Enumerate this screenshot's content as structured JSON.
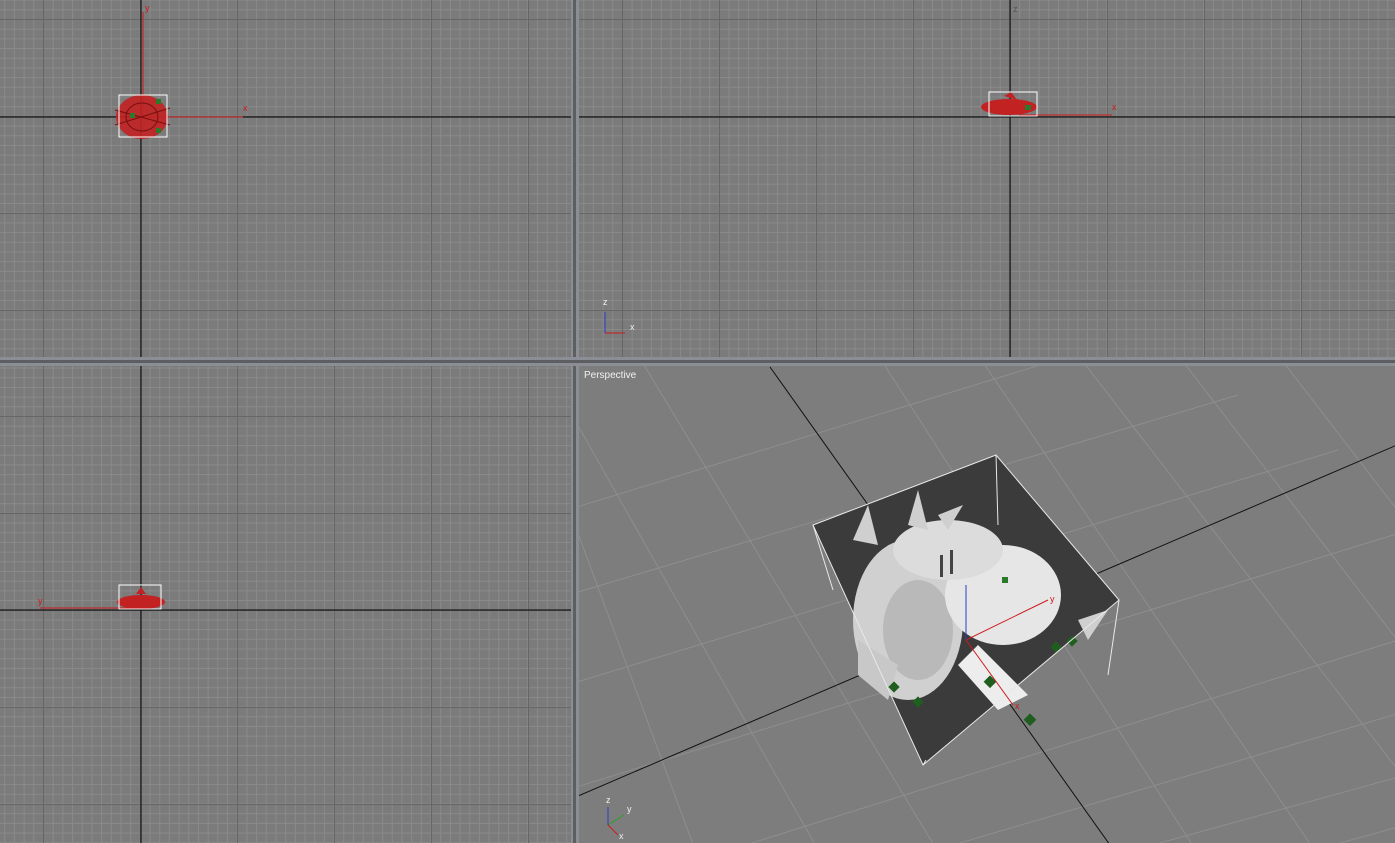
{
  "viewports": {
    "top": {
      "axis_x": "x",
      "axis_y": "y"
    },
    "front": {
      "axis_x": "x",
      "axis_z": "z",
      "tripod_z": "z",
      "tripod_x": "x"
    },
    "left": {
      "axis_y": "y"
    },
    "perspective": {
      "label": "Perspective",
      "axis_x": "x",
      "axis_y": "y",
      "tripod_z": "z",
      "tripod_y": "y",
      "tripod_x": "x"
    }
  },
  "colors": {
    "active_border": "#e5e04a",
    "selection_color": "#cc1a1a",
    "gizmo_green": "#2b7a2b"
  }
}
